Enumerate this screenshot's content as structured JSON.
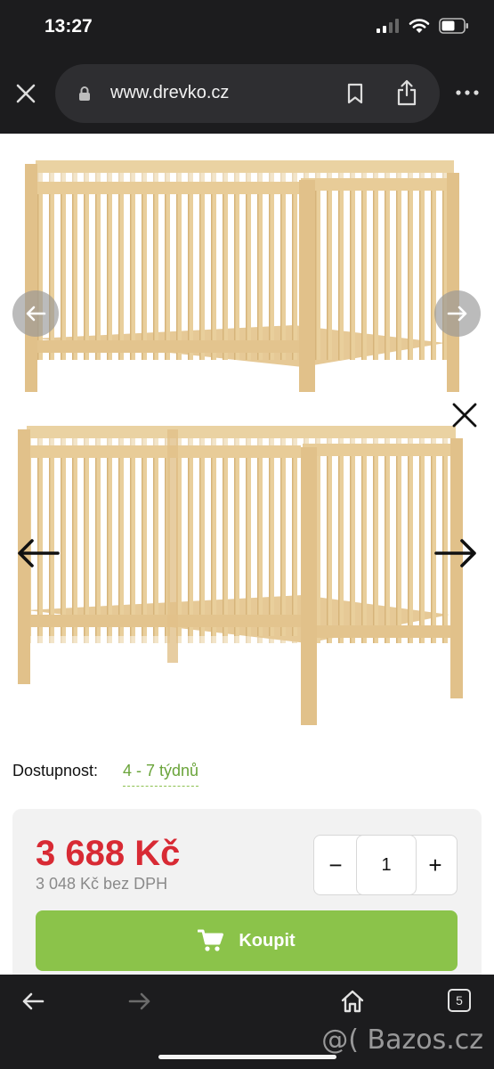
{
  "status_bar": {
    "time": "13:27"
  },
  "browser": {
    "url": "www.drevko.cz"
  },
  "product": {
    "availability_label": "Dostupnost:",
    "availability_value": "4 - 7 týdnů",
    "price": "3 688 Kč",
    "price_without_vat": "3 048 Kč bez DPH",
    "quantity": "1",
    "minus_label": "−",
    "plus_label": "+",
    "buy_label": "Koupit"
  },
  "bottom_bar": {
    "tab_count": "5"
  },
  "watermark": "@( Bazos.cz",
  "colors": {
    "price": "#d82a34",
    "availability": "#6aa43a",
    "buy_button": "#8bc34a",
    "chrome": "#1c1c1e"
  },
  "icons": [
    "close-icon",
    "lock-icon",
    "bookmark-icon",
    "share-icon",
    "more-icon",
    "arrow-left-icon",
    "arrow-right-icon",
    "cart-icon",
    "back-icon",
    "forward-icon",
    "home-icon",
    "tabs-icon"
  ]
}
